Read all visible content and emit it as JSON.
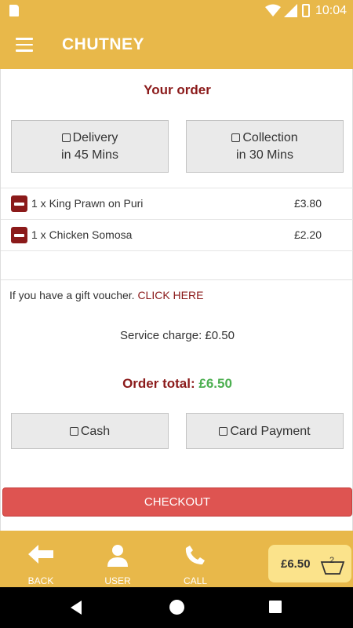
{
  "status_bar": {
    "time": "10:04"
  },
  "app_bar": {
    "title": "CHUTNEY"
  },
  "order": {
    "heading": "Your order",
    "delivery": {
      "line1": "Delivery",
      "line2": "in 45 Mins"
    },
    "collection": {
      "line1": "Collection",
      "line2": "in 30 Mins"
    },
    "items": [
      {
        "name": "1 x King Prawn on Puri",
        "price": "£3.80"
      },
      {
        "name": "1 x Chicken Somosa",
        "price": "£2.20"
      }
    ],
    "gift_text": "If you have a gift voucher.",
    "gift_link": "CLICK HERE",
    "service_charge": "Service charge: £0.50",
    "total_label": "Order total:",
    "total_value": "£6.50",
    "payment": {
      "cash": "Cash",
      "card": "Card Payment"
    },
    "checkout_label": "CHECKOUT"
  },
  "bottom_nav": {
    "back": "BACK",
    "user": "USER",
    "call": "CALL",
    "cart_total": "£6.50",
    "cart_count": "2"
  },
  "colors": {
    "brand": "#e8b84a",
    "heading": "#8b1a1a",
    "total_green": "#4caf50",
    "checkout": "#de5451"
  }
}
